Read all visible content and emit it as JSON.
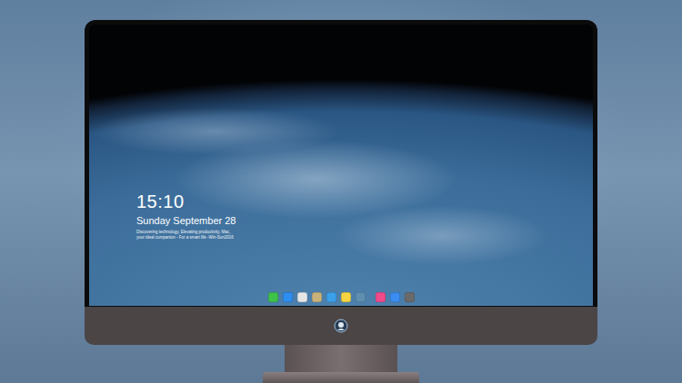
{
  "lock_screen": {
    "time": "15:10",
    "date": "Sunday September 28",
    "tagline": [
      "Discovering technology, Elevating productivity, Mac,",
      "your ideal companion - For a smart life -Win-Sun2016"
    ]
  },
  "dock": {
    "items": [
      {
        "color": "#3ec24a"
      },
      {
        "color": "#2d8ef0"
      },
      {
        "color": "#e6e6e6"
      },
      {
        "color": "#c9b27a"
      },
      {
        "color": "#3aa0e8"
      },
      {
        "color": "#f5d442"
      },
      {
        "color": "#5f8fb0"
      },
      {
        "color": "#f04a8a"
      },
      {
        "color": "#3a8cf0"
      },
      {
        "color": "#6a6a6a"
      }
    ]
  }
}
